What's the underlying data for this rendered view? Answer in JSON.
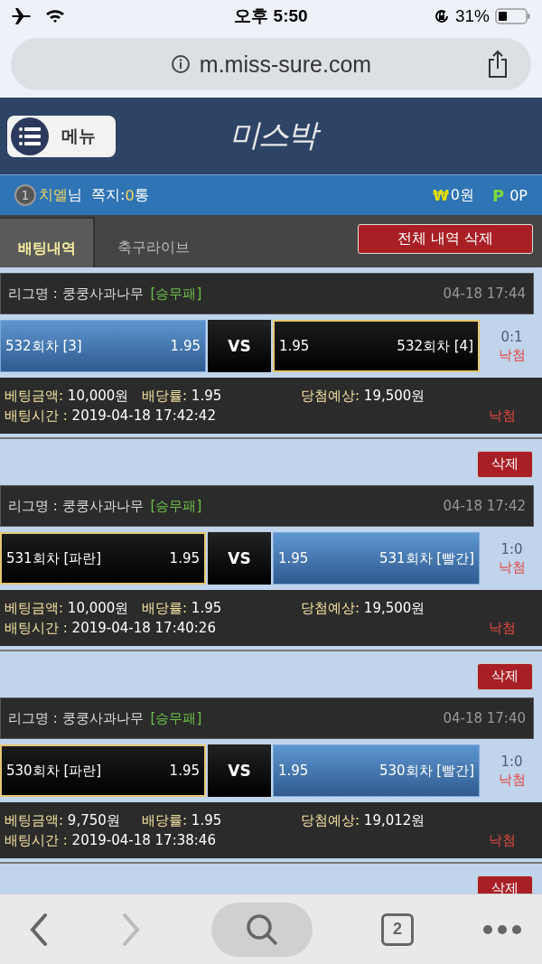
{
  "status_bar": {
    "time": "오후 5:50",
    "battery": "31%"
  },
  "browser": {
    "url": "m.miss-sure.com",
    "tab_count": "2"
  },
  "header": {
    "menu_label": "메뉴",
    "logo": "미스박"
  },
  "user_bar": {
    "level": "1",
    "name": "치엘",
    "honorific": "님",
    "messages_label": "쪽지:",
    "messages_count": "0",
    "messages_unit": "통",
    "money_symbol": "₩",
    "money": "0원",
    "points_symbol": "P",
    "points": "0P"
  },
  "tabs": [
    {
      "label": "배팅내역",
      "selected": true
    },
    {
      "label": "축구라이브",
      "selected": false
    }
  ],
  "delete_all_button": "전체 내역 삭제",
  "rows": [
    {
      "kind": "bet",
      "league_label": "리그명 : 쿵쿵사과나무",
      "market": "[승무패]",
      "date": "04-18 17:44",
      "home": {
        "name": "532회차 [3]",
        "odds": "1.95",
        "picked": false
      },
      "vs": "VS",
      "away": {
        "name": "532회차 [4]",
        "odds": "1.95",
        "picked": true
      },
      "score": "0:1",
      "result": "낙첨",
      "amount_label": "베팅금액:",
      "amount": "10,000원",
      "rate_label": "배당률:",
      "rate": "1.95",
      "expected_label": "당첨예상:",
      "expected": "19,500원",
      "time_label": "배팅시간 :",
      "time": "2019-04-18 17:42:42",
      "status": "낙첨"
    },
    {
      "kind": "delete",
      "label": "삭제"
    },
    {
      "kind": "bet",
      "league_label": "리그명 : 쿵쿵사과나무",
      "market": "[승무패]",
      "date": "04-18 17:42",
      "home": {
        "name": "531회차 [파란]",
        "odds": "1.95",
        "picked": true
      },
      "vs": "VS",
      "away": {
        "name": "531회차 [빨간]",
        "odds": "1.95",
        "picked": false
      },
      "score": "1:0",
      "result": "낙첨",
      "amount_label": "베팅금액:",
      "amount": "10,000원",
      "rate_label": "배당률:",
      "rate": "1.95",
      "expected_label": "당첨예상:",
      "expected": "19,500원",
      "time_label": "배팅시간 :",
      "time": "2019-04-18 17:40:26",
      "status": "낙첨"
    },
    {
      "kind": "delete",
      "label": "삭제"
    },
    {
      "kind": "bet",
      "league_label": "리그명 : 쿵쿵사과나무",
      "market": "[승무패]",
      "date": "04-18 17:40",
      "home": {
        "name": "530회차 [파란]",
        "odds": "1.95",
        "picked": true
      },
      "vs": "VS",
      "away": {
        "name": "530회차 [빨간]",
        "odds": "1.95",
        "picked": false
      },
      "score": "1:0",
      "result": "낙첨",
      "amount_label": "베팅금액:",
      "amount": "9,750원",
      "rate_label": "배당률:",
      "rate": "1.95",
      "expected_label": "당첨예상:",
      "expected": "19,012원",
      "time_label": "배팅시간 :",
      "time": "2019-04-18 17:38:46",
      "status": "낙첨"
    },
    {
      "kind": "delete",
      "label": "삭제"
    }
  ]
}
